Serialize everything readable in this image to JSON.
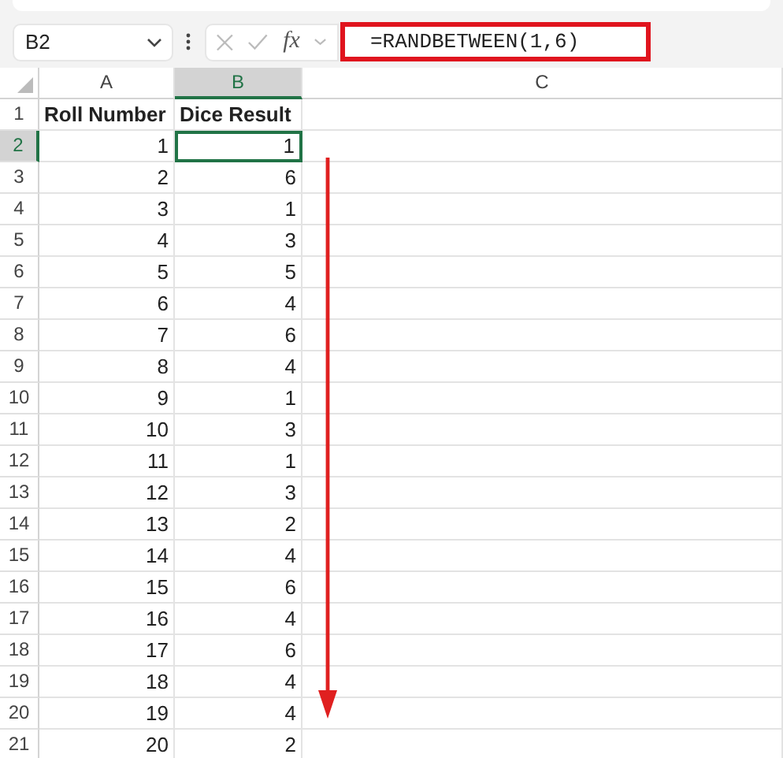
{
  "name_box": "B2",
  "function_label": "fx",
  "formula": {
    "text": "=RANDBETWEEN(1,6)",
    "highlighted": true
  },
  "columns": [
    {
      "label": "A",
      "selected": false
    },
    {
      "label": "B",
      "selected": true
    },
    {
      "label": "C",
      "selected": false
    }
  ],
  "rows": [
    {
      "number": "1",
      "selected": false,
      "kind": "header",
      "cells": [
        {
          "text": "Roll Number",
          "selected": false
        },
        {
          "text": "Dice Result",
          "selected": false
        }
      ]
    },
    {
      "number": "2",
      "selected": true,
      "kind": "value",
      "cells": [
        {
          "text": "1",
          "selected": false
        },
        {
          "text": "1",
          "selected": true
        }
      ]
    },
    {
      "number": "3",
      "selected": false,
      "kind": "value",
      "cells": [
        {
          "text": "2",
          "selected": false
        },
        {
          "text": "6",
          "selected": false
        }
      ]
    },
    {
      "number": "4",
      "selected": false,
      "kind": "value",
      "cells": [
        {
          "text": "3",
          "selected": false
        },
        {
          "text": "1",
          "selected": false
        }
      ]
    },
    {
      "number": "5",
      "selected": false,
      "kind": "value",
      "cells": [
        {
          "text": "4",
          "selected": false
        },
        {
          "text": "3",
          "selected": false
        }
      ]
    },
    {
      "number": "6",
      "selected": false,
      "kind": "value",
      "cells": [
        {
          "text": "5",
          "selected": false
        },
        {
          "text": "5",
          "selected": false
        }
      ]
    },
    {
      "number": "7",
      "selected": false,
      "kind": "value",
      "cells": [
        {
          "text": "6",
          "selected": false
        },
        {
          "text": "4",
          "selected": false
        }
      ]
    },
    {
      "number": "8",
      "selected": false,
      "kind": "value",
      "cells": [
        {
          "text": "7",
          "selected": false
        },
        {
          "text": "6",
          "selected": false
        }
      ]
    },
    {
      "number": "9",
      "selected": false,
      "kind": "value",
      "cells": [
        {
          "text": "8",
          "selected": false
        },
        {
          "text": "4",
          "selected": false
        }
      ]
    },
    {
      "number": "10",
      "selected": false,
      "kind": "value",
      "cells": [
        {
          "text": "9",
          "selected": false
        },
        {
          "text": "1",
          "selected": false
        }
      ]
    },
    {
      "number": "11",
      "selected": false,
      "kind": "value",
      "cells": [
        {
          "text": "10",
          "selected": false
        },
        {
          "text": "3",
          "selected": false
        }
      ]
    },
    {
      "number": "12",
      "selected": false,
      "kind": "value",
      "cells": [
        {
          "text": "11",
          "selected": false
        },
        {
          "text": "1",
          "selected": false
        }
      ]
    },
    {
      "number": "13",
      "selected": false,
      "kind": "value",
      "cells": [
        {
          "text": "12",
          "selected": false
        },
        {
          "text": "3",
          "selected": false
        }
      ]
    },
    {
      "number": "14",
      "selected": false,
      "kind": "value",
      "cells": [
        {
          "text": "13",
          "selected": false
        },
        {
          "text": "2",
          "selected": false
        }
      ]
    },
    {
      "number": "15",
      "selected": false,
      "kind": "value",
      "cells": [
        {
          "text": "14",
          "selected": false
        },
        {
          "text": "4",
          "selected": false
        }
      ]
    },
    {
      "number": "16",
      "selected": false,
      "kind": "value",
      "cells": [
        {
          "text": "15",
          "selected": false
        },
        {
          "text": "6",
          "selected": false
        }
      ]
    },
    {
      "number": "17",
      "selected": false,
      "kind": "value",
      "cells": [
        {
          "text": "16",
          "selected": false
        },
        {
          "text": "4",
          "selected": false
        }
      ]
    },
    {
      "number": "18",
      "selected": false,
      "kind": "value",
      "cells": [
        {
          "text": "17",
          "selected": false
        },
        {
          "text": "6",
          "selected": false
        }
      ]
    },
    {
      "number": "19",
      "selected": false,
      "kind": "value",
      "cells": [
        {
          "text": "18",
          "selected": false
        },
        {
          "text": "4",
          "selected": false
        }
      ]
    },
    {
      "number": "20",
      "selected": false,
      "kind": "value",
      "cells": [
        {
          "text": "19",
          "selected": false
        },
        {
          "text": "4",
          "selected": false
        }
      ]
    },
    {
      "number": "21",
      "selected": false,
      "kind": "value",
      "cells": [
        {
          "text": "20",
          "selected": false
        },
        {
          "text": "2",
          "selected": false
        }
      ]
    }
  ]
}
